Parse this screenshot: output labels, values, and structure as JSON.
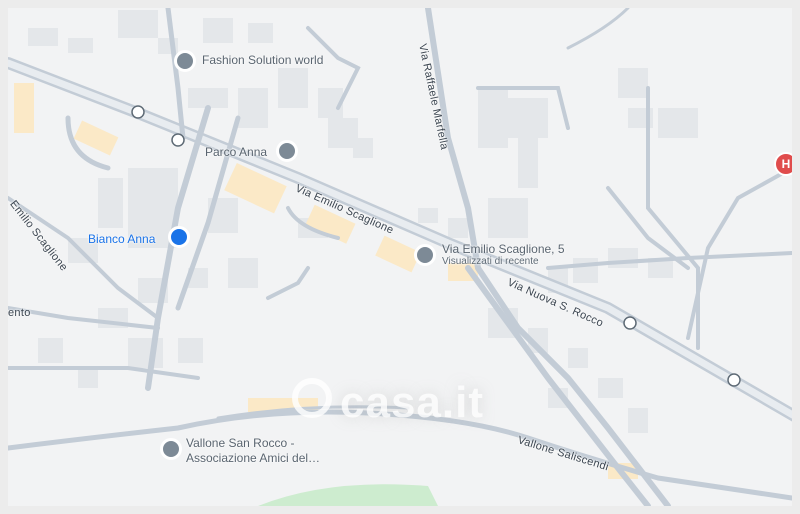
{
  "map": {
    "streets": {
      "emilio_scaglione": "Via Emilio Scaglione",
      "emilio_scaglione_left": "Emilio Scaglione",
      "raffaele_marfella": "Via Raffaele Marfella",
      "nuova_s_rocco": "Via Nuova S. Rocco",
      "vallone_saliscendi": "Vallone Saliscendi",
      "left_edge": "ento"
    },
    "places": {
      "fashion_solution": "Fashion Solution world",
      "parco_anna": "Parco Anna",
      "bianco_anna": "Bianco Anna",
      "vallone_san_rocco_line1": "Vallone San Rocco -",
      "vallone_san_rocco_line2": "Associazione Amici del…"
    },
    "selected": {
      "title": "Via Emilio Scaglione, 5",
      "subtitle": "Visualizzati di recente"
    },
    "hospital_marker": "H",
    "watermark": "casa.it",
    "colors": {
      "map_bg": "#f2f3f4",
      "road": "#c3ccd6",
      "building": "#e4e7ea",
      "building_highlight": "#fbe9c7",
      "park": "#cdeccf",
      "pin_gray": "#7d8a96",
      "shop_blue": "#1a73e8",
      "hospital_red": "#e04c4c"
    }
  }
}
